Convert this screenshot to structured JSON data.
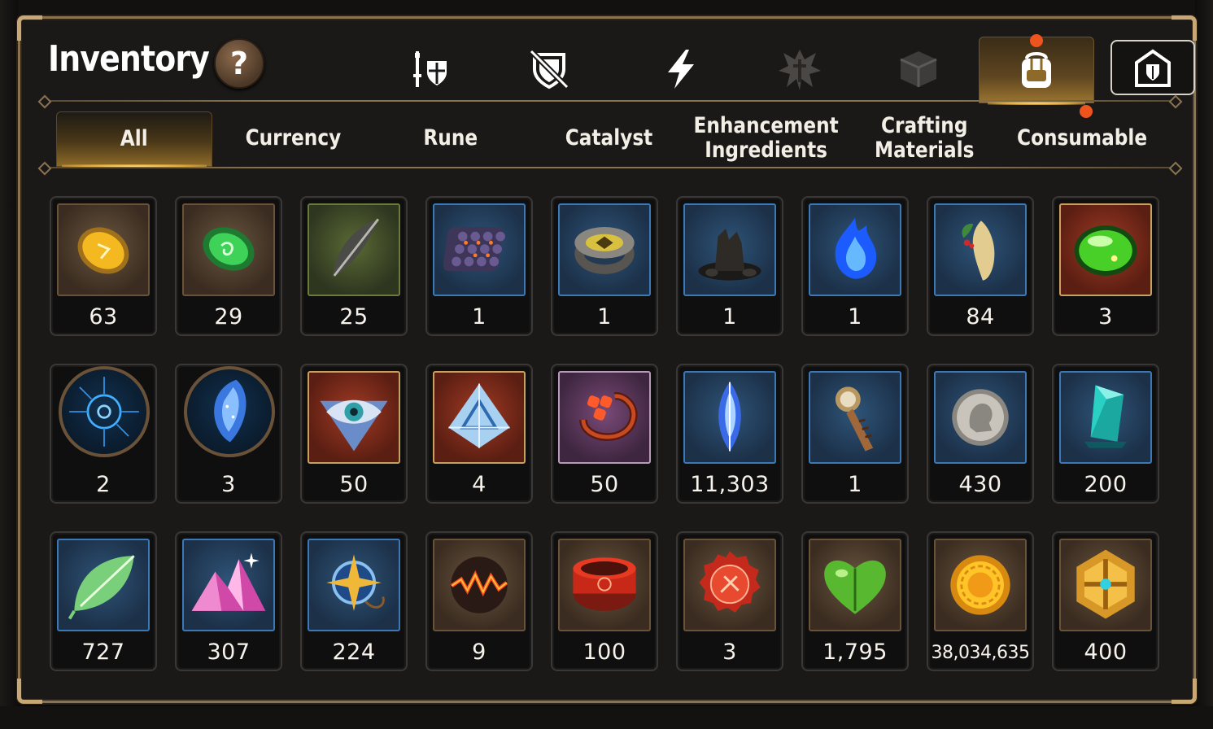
{
  "header": {
    "title": "Inventory",
    "help_label": "?"
  },
  "top_tabs": [
    {
      "icon": "sword-shield-icon",
      "active": false
    },
    {
      "icon": "broken-shield-icon",
      "active": false
    },
    {
      "icon": "lightning-icon",
      "active": false
    },
    {
      "icon": "demon-emblem-icon",
      "active": false
    },
    {
      "icon": "cube-icon",
      "active": false
    },
    {
      "icon": "backpack-icon",
      "active": true,
      "badge": true
    },
    {
      "icon": "guild-castle-icon",
      "active": false
    }
  ],
  "category_tabs": [
    {
      "label": "All",
      "active": true
    },
    {
      "label": "Currency",
      "active": false
    },
    {
      "label": "Rune",
      "active": false
    },
    {
      "label": "Catalyst",
      "active": false
    },
    {
      "label": "Enhancement\nIngredients",
      "active": false
    },
    {
      "label": "Crafting\nMaterials",
      "active": false
    },
    {
      "label": "Consumable",
      "active": false,
      "badge": true
    }
  ],
  "items": [
    {
      "icon": "amber-gem-icon",
      "qty": "63"
    },
    {
      "icon": "jade-rune-stone-icon",
      "qty": "29"
    },
    {
      "icon": "dark-feather-icon",
      "qty": "25"
    },
    {
      "icon": "scale-armor-plate-icon",
      "qty": "1"
    },
    {
      "icon": "engraved-ring-icon",
      "qty": "1"
    },
    {
      "icon": "charred-stump-icon",
      "qty": "1"
    },
    {
      "icon": "blue-flame-icon",
      "qty": "1"
    },
    {
      "icon": "ginseng-root-icon",
      "qty": "84"
    },
    {
      "icon": "green-potion-icon",
      "qty": "3"
    },
    {
      "icon": "blue-rune-orb-icon",
      "qty": "2"
    },
    {
      "icon": "crystal-shard-orb-icon",
      "qty": "3"
    },
    {
      "icon": "eye-emblem-icon",
      "qty": "50"
    },
    {
      "icon": "triangle-crystal-icon",
      "qty": "4"
    },
    {
      "icon": "clover-ring-icon",
      "qty": "50"
    },
    {
      "icon": "blue-diamond-icon",
      "qty": "11,303"
    },
    {
      "icon": "compass-key-icon",
      "qty": "1"
    },
    {
      "icon": "silver-coin-icon",
      "qty": "430"
    },
    {
      "icon": "teal-crystal-icon",
      "qty": "200"
    },
    {
      "icon": "glowing-leaf-icon",
      "qty": "727"
    },
    {
      "icon": "pink-crystal-mountain-icon",
      "qty": "307"
    },
    {
      "icon": "star-amulet-icon",
      "qty": "224"
    },
    {
      "icon": "lava-orb-icon",
      "qty": "9"
    },
    {
      "icon": "red-bracelet-icon",
      "qty": "100"
    },
    {
      "icon": "red-seal-badge-icon",
      "qty": "3"
    },
    {
      "icon": "green-heart-icon",
      "qty": "1,795"
    },
    {
      "icon": "gold-sun-coin-icon",
      "qty": "38,034,635"
    },
    {
      "icon": "gold-hex-emblem-icon",
      "qty": "400"
    }
  ],
  "colors": {
    "accent_gold": "#8a7350",
    "badge_orange": "#f0541e",
    "rare_blue": "#3d78b6"
  }
}
